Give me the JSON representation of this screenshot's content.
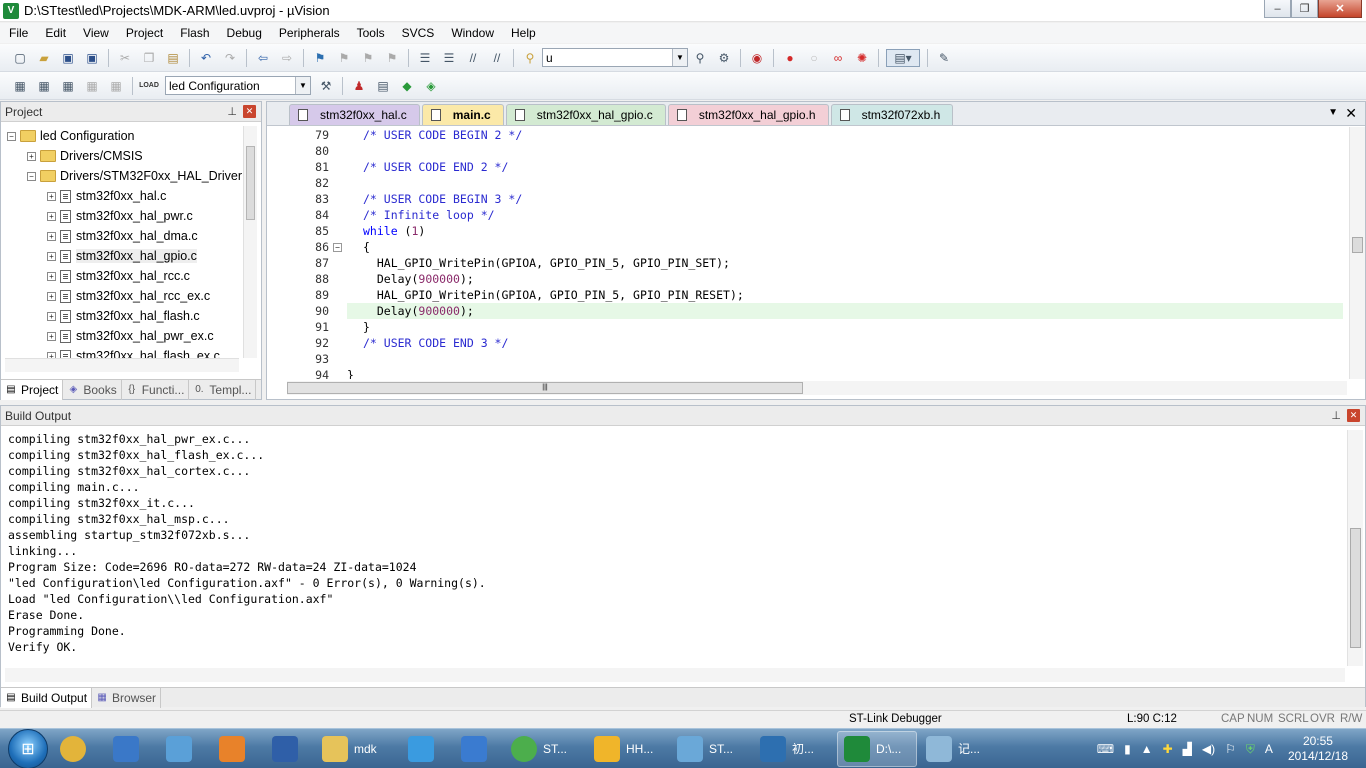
{
  "window": {
    "title": "D:\\STtest\\led\\Projects\\MDK-ARM\\led.uvproj - µVision",
    "minimize_glyph": "–",
    "maximize_glyph": "❐",
    "close_glyph": "✕"
  },
  "menu": [
    "File",
    "Edit",
    "View",
    "Project",
    "Flash",
    "Debug",
    "Peripherals",
    "Tools",
    "SVCS",
    "Window",
    "Help"
  ],
  "toolbar1": {
    "find_value": "u"
  },
  "toolbar2": {
    "target_value": "led Configuration",
    "load_label": "LOAD"
  },
  "project_panel": {
    "title": "Project",
    "tree": [
      {
        "label": "led Configuration",
        "level": 0,
        "kind": "root",
        "expander": "−"
      },
      {
        "label": "Drivers/CMSIS",
        "level": 1,
        "kind": "folder",
        "expander": "+"
      },
      {
        "label": "Drivers/STM32F0xx_HAL_Driver",
        "level": 1,
        "kind": "folder",
        "expander": "−"
      },
      {
        "label": "stm32f0xx_hal.c",
        "level": 2,
        "kind": "file",
        "expander": "+"
      },
      {
        "label": "stm32f0xx_hal_pwr.c",
        "level": 2,
        "kind": "file",
        "expander": "+"
      },
      {
        "label": "stm32f0xx_hal_dma.c",
        "level": 2,
        "kind": "file",
        "expander": "+"
      },
      {
        "label": "stm32f0xx_hal_gpio.c",
        "level": 2,
        "kind": "file",
        "expander": "+"
      },
      {
        "label": "stm32f0xx_hal_rcc.c",
        "level": 2,
        "kind": "file",
        "expander": "+"
      },
      {
        "label": "stm32f0xx_hal_rcc_ex.c",
        "level": 2,
        "kind": "file",
        "expander": "+"
      },
      {
        "label": "stm32f0xx_hal_flash.c",
        "level": 2,
        "kind": "file",
        "expander": "+"
      },
      {
        "label": "stm32f0xx_hal_pwr_ex.c",
        "level": 2,
        "kind": "file",
        "expander": "+"
      },
      {
        "label": "stm32f0xx_hal_flash_ex.c",
        "level": 2,
        "kind": "file",
        "expander": "+"
      }
    ],
    "tabs": [
      {
        "label": "Project",
        "icon": "▤",
        "active": true
      },
      {
        "label": "Books",
        "icon": "◈",
        "active": false
      },
      {
        "label": "Functi...",
        "icon": "{}",
        "active": false
      },
      {
        "label": "Templ...",
        "icon": "0.",
        "active": false
      }
    ]
  },
  "editor": {
    "tabs": [
      {
        "label": "stm32f0xx_hal.c",
        "color": "purple"
      },
      {
        "label": "main.c",
        "color": "yellow"
      },
      {
        "label": "stm32f0xx_hal_gpio.c",
        "color": "green"
      },
      {
        "label": "stm32f0xx_hal_gpio.h",
        "color": "pink"
      },
      {
        "label": "stm32f072xb.h",
        "color": "teal"
      }
    ],
    "lines": [
      {
        "n": "79",
        "text": "/* USER CODE BEGIN 2 */",
        "type": "comment-blue"
      },
      {
        "n": "80",
        "text": "",
        "type": "plain"
      },
      {
        "n": "81",
        "text": "/* USER CODE END 2 */",
        "type": "comment-blue"
      },
      {
        "n": "82",
        "text": "",
        "type": "plain"
      },
      {
        "n": "83",
        "text": "/* USER CODE BEGIN 3 */",
        "type": "comment-blue"
      },
      {
        "n": "84",
        "text": "/* Infinite loop */",
        "type": "comment-blue"
      },
      {
        "n": "85",
        "text": "while (1)",
        "type": "while"
      },
      {
        "n": "86",
        "text": "{",
        "type": "plain",
        "fold": "−"
      },
      {
        "n": "87",
        "text": "  HAL_GPIO_WritePin(GPIOA, GPIO_PIN_5, GPIO_PIN_SET);",
        "type": "plain"
      },
      {
        "n": "88",
        "text": "  Delay(900000);",
        "type": "delay",
        "arg": "900000"
      },
      {
        "n": "89",
        "text": "  HAL_GPIO_WritePin(GPIOA, GPIO_PIN_5, GPIO_PIN_RESET);",
        "type": "plain"
      },
      {
        "n": "90",
        "text": "  Delay(900000);",
        "type": "delay",
        "arg": "900000",
        "current": true
      },
      {
        "n": "91",
        "text": "}",
        "type": "plain"
      },
      {
        "n": "92",
        "text": "/* USER CODE END 3 */",
        "type": "comment-blue"
      },
      {
        "n": "93",
        "text": "",
        "type": "plain"
      },
      {
        "n": "94",
        "text": "}",
        "type": "plain"
      }
    ]
  },
  "build_output": {
    "title": "Build Output",
    "lines": [
      "compiling stm32f0xx_hal_pwr_ex.c...",
      "compiling stm32f0xx_hal_flash_ex.c...",
      "compiling stm32f0xx_hal_cortex.c...",
      "compiling main.c...",
      "compiling stm32f0xx_it.c...",
      "compiling stm32f0xx_hal_msp.c...",
      "assembling startup_stm32f072xb.s...",
      "linking...",
      "Program Size: Code=2696 RO-data=272 RW-data=24 ZI-data=1024",
      "\"led Configuration\\led Configuration.axf\" - 0 Error(s), 0 Warning(s).",
      "Load \"led Configuration\\\\led Configuration.axf\"",
      "Erase Done.",
      "Programming Done.",
      "Verify OK."
    ],
    "tabs": [
      {
        "label": "Build Output",
        "active": true
      },
      {
        "label": "Browser",
        "active": false
      }
    ]
  },
  "status": {
    "debugger": "ST-Link Debugger",
    "position": "L:90 C:12",
    "cap": "CAP",
    "num": "NUM",
    "scrl": "SCRL",
    "ovr": "OVR",
    "rw": "R/W"
  },
  "taskbar": {
    "apps": [
      {
        "label": "",
        "color": "#e3b43a"
      },
      {
        "label": "",
        "color": "#3a78c8"
      },
      {
        "label": "",
        "color": "#5aa0d8"
      },
      {
        "label": "",
        "color": "#e8822a"
      },
      {
        "label": "",
        "color": "#2f5fa8"
      },
      {
        "label": "mdk",
        "color": "#e6c35a"
      },
      {
        "label": "",
        "color": "#3a9be0"
      },
      {
        "label": "",
        "color": "#3a7bd0"
      },
      {
        "label": "ST...",
        "color": "#4cae4c"
      },
      {
        "label": "HH...",
        "color": "#f0b52a"
      },
      {
        "label": "ST...",
        "color": "#6aa8d8"
      },
      {
        "label": "初...",
        "color": "#2d6fb0"
      },
      {
        "label": "D:\\...",
        "color": "#1f8a3a",
        "active": true
      },
      {
        "label": "记...",
        "color": "#8fb8d8"
      }
    ],
    "time": "20:55",
    "date": "2014/12/18"
  }
}
